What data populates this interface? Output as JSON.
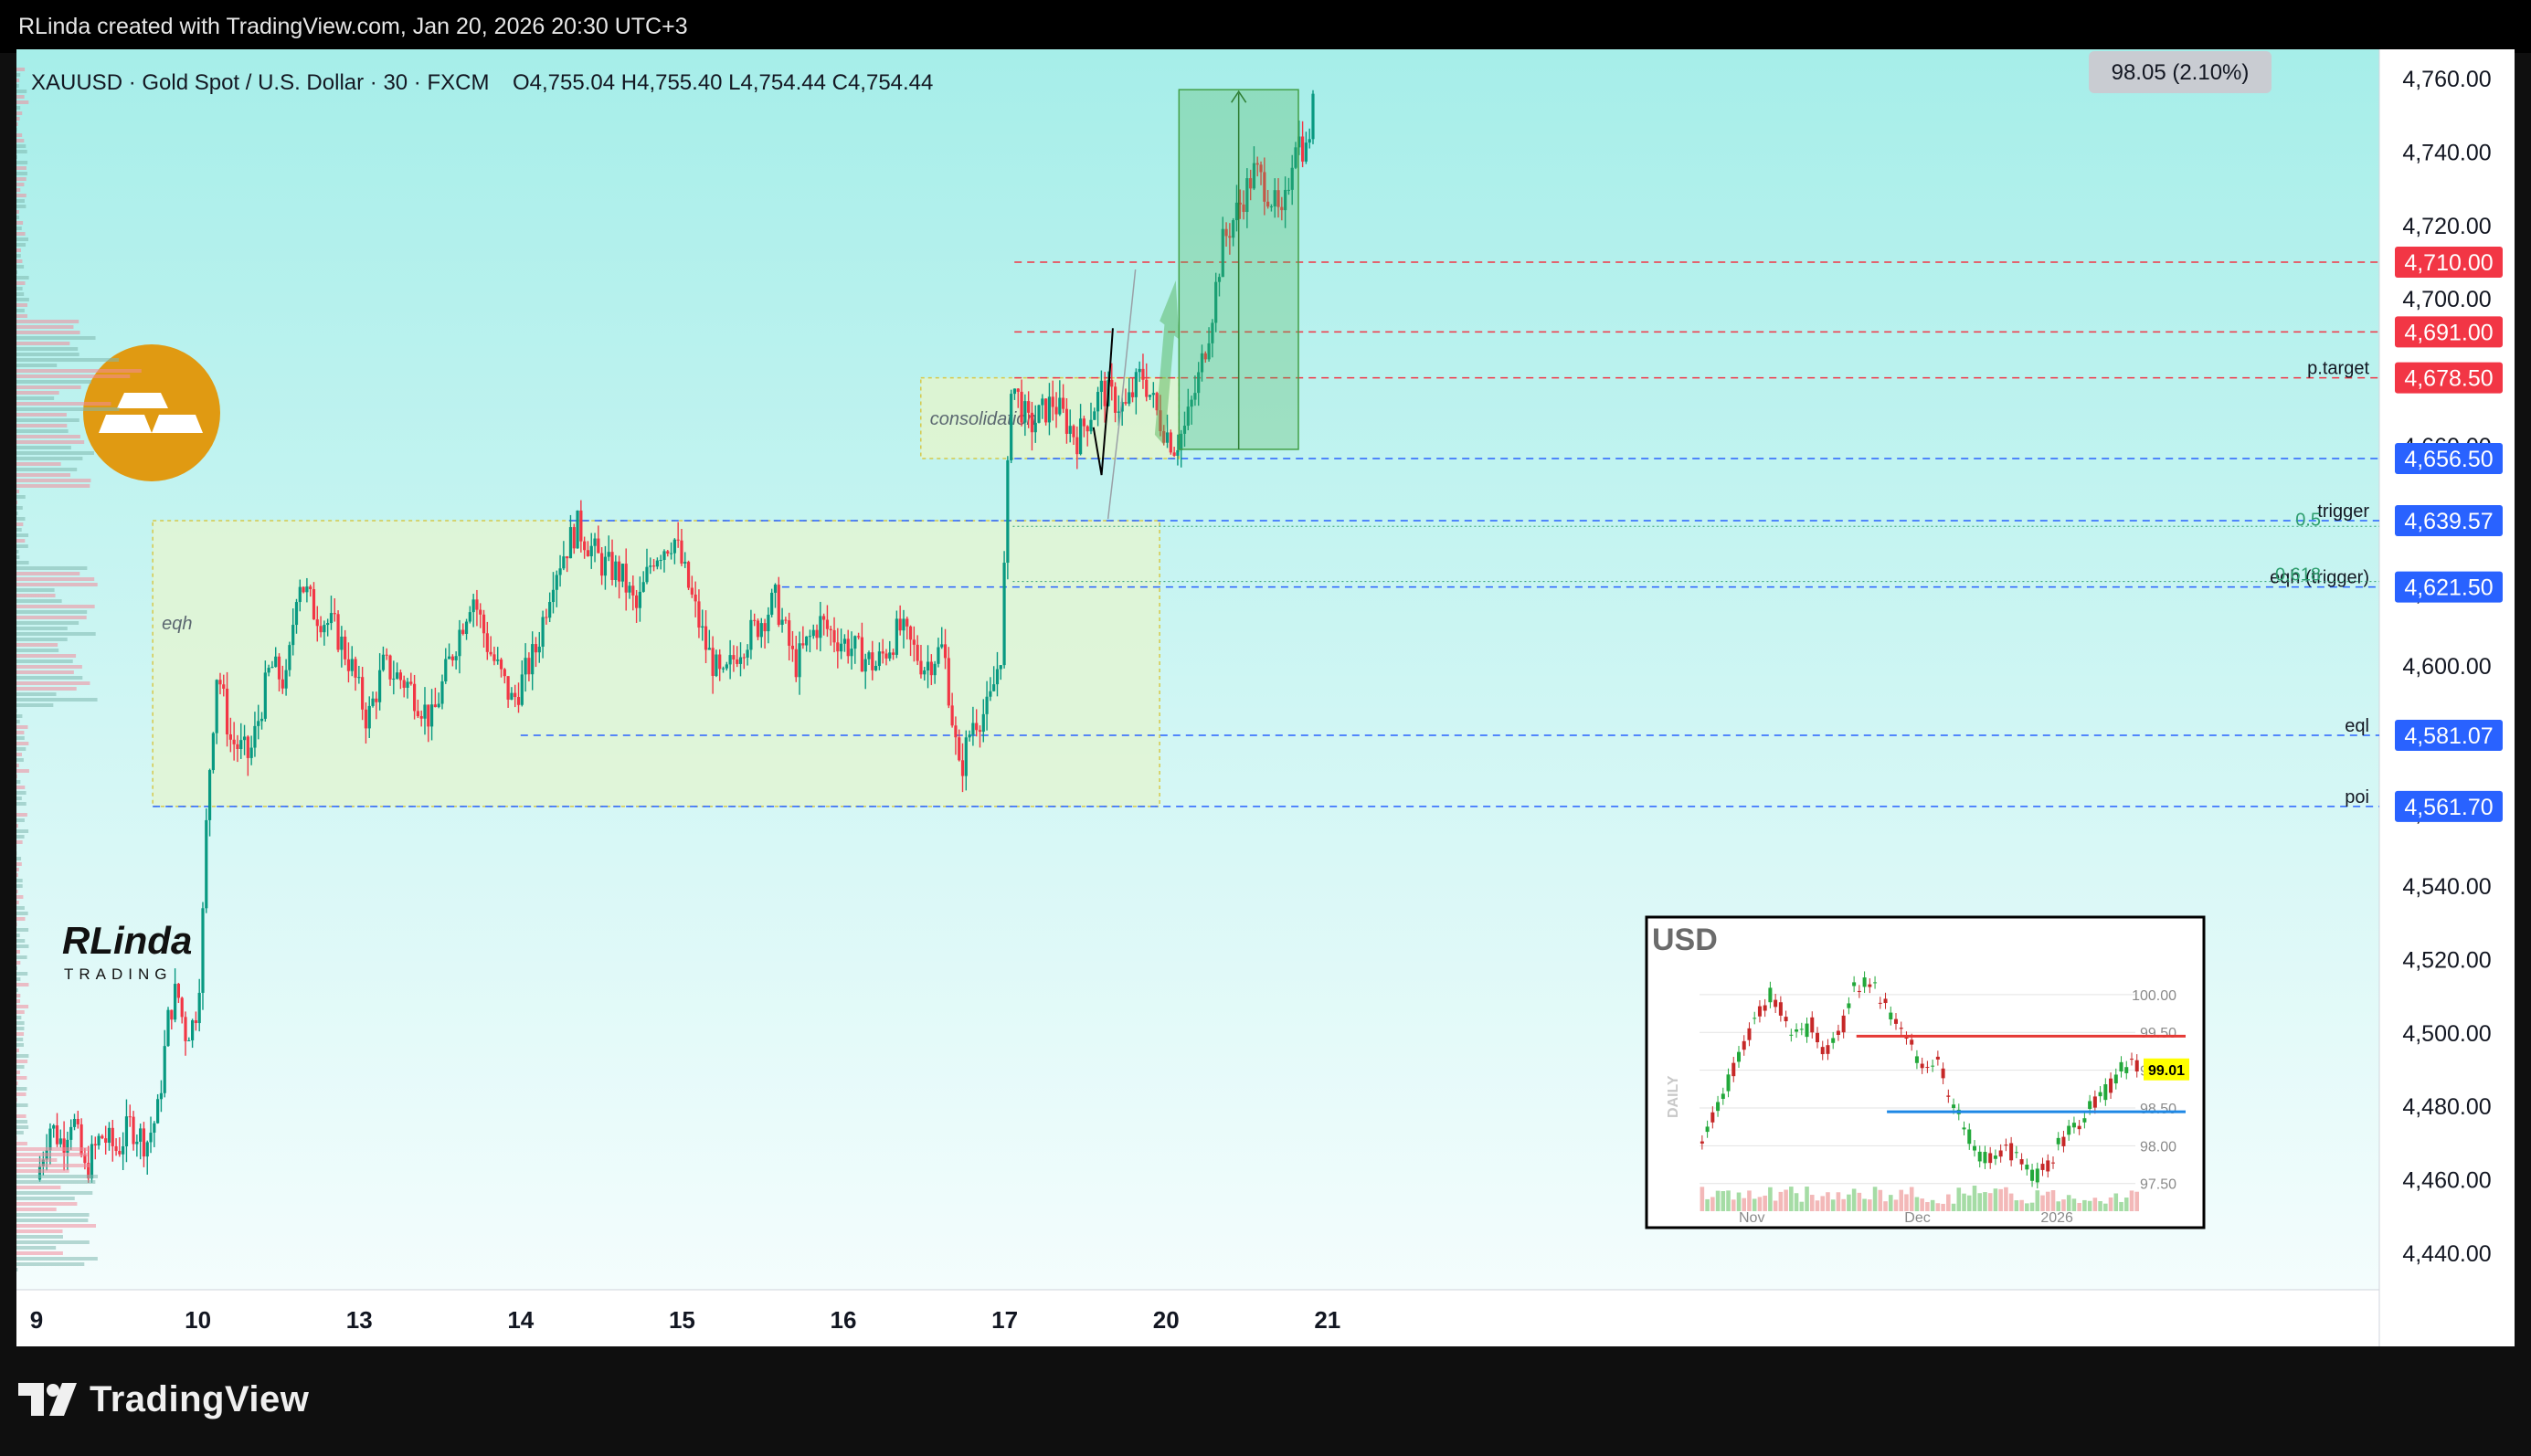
{
  "top_bar": {
    "credit": "RLinda created with TradingView.com, Jan 20, 2026 20:30 UTC+3"
  },
  "header": {
    "symbol": "XAUUSD · Gold Spot / U.S. Dollar · 30 · FXCM",
    "ohlc": "O4,755.04  H4,755.40  L4,754.44  C4,754.44"
  },
  "measure_label": "98.05 (2.10%)",
  "watermark": {
    "brand_line1": "RLinda",
    "brand_line2": "TRADING"
  },
  "footer": {
    "brand": "TradingView"
  },
  "colors": {
    "up": "#089981",
    "down": "#f23645",
    "bg_top": "#a6eee9",
    "bg_bottom": "#f4fdfd",
    "zone": "#e2f4d4",
    "level_red": "#f23645",
    "level_blue": "#2962ff",
    "logo_gold": "#e09a12"
  },
  "chart_data": {
    "type": "candlestick",
    "y_axis": {
      "min": 4430,
      "max": 4768,
      "ticks": [
        4440,
        4460,
        4480,
        4500,
        4520,
        4540,
        4560,
        4580,
        4600,
        4620,
        4640,
        4660,
        4680,
        4700,
        4720,
        4740,
        4760
      ],
      "tick_labels": [
        "4,440.00",
        "4,460.00",
        "4,480.00",
        "4,500.00",
        "4,520.00",
        "4,540.00",
        "4,560.00",
        "4,580.00",
        "4,600.00",
        "4,620.00",
        "4,640.00",
        "4,660.00",
        "4,680.00",
        "4,700.00",
        "4,720.00",
        "4,740.00",
        "4,760.00"
      ]
    },
    "x_axis": {
      "labels": [
        "9",
        "10",
        "13",
        "14",
        "15",
        "16",
        "17",
        "20",
        "21"
      ],
      "positions": [
        0.0,
        1.0,
        2.0,
        3.0,
        4.0,
        5.0,
        6.0,
        7.0,
        8.0
      ]
    },
    "price_path": [
      [
        0.0,
        4460
      ],
      [
        0.08,
        4475
      ],
      [
        0.16,
        4470
      ],
      [
        0.22,
        4478
      ],
      [
        0.3,
        4462
      ],
      [
        0.4,
        4472
      ],
      [
        0.5,
        4468
      ],
      [
        0.58,
        4475
      ],
      [
        0.68,
        4470
      ],
      [
        0.75,
        4478
      ],
      [
        0.82,
        4505
      ],
      [
        0.87,
        4512
      ],
      [
        0.92,
        4500
      ],
      [
        0.98,
        4503
      ],
      [
        1.02,
        4520
      ],
      [
        1.06,
        4565
      ],
      [
        1.12,
        4600
      ],
      [
        1.2,
        4580
      ],
      [
        1.32,
        4575
      ],
      [
        1.45,
        4600
      ],
      [
        1.55,
        4595
      ],
      [
        1.62,
        4625
      ],
      [
        1.72,
        4615
      ],
      [
        1.85,
        4610
      ],
      [
        1.95,
        4600
      ],
      [
        2.05,
        4585
      ],
      [
        2.15,
        4600
      ],
      [
        2.3,
        4595
      ],
      [
        2.45,
        4585
      ],
      [
        2.55,
        4600
      ],
      [
        2.7,
        4620
      ],
      [
        2.8,
        4605
      ],
      [
        2.95,
        4590
      ],
      [
        3.1,
        4605
      ],
      [
        3.2,
        4625
      ],
      [
        3.35,
        4638
      ],
      [
        3.5,
        4628
      ],
      [
        3.62,
        4625
      ],
      [
        3.72,
        4615
      ],
      [
        3.82,
        4630
      ],
      [
        3.95,
        4635
      ],
      [
        4.05,
        4620
      ],
      [
        4.15,
        4605
      ],
      [
        4.25,
        4595
      ],
      [
        4.35,
        4605
      ],
      [
        4.45,
        4610
      ],
      [
        4.58,
        4618
      ],
      [
        4.7,
        4600
      ],
      [
        4.85,
        4612
      ],
      [
        4.95,
        4608
      ],
      [
        5.05,
        4605
      ],
      [
        5.2,
        4600
      ],
      [
        5.35,
        4610
      ],
      [
        5.5,
        4600
      ],
      [
        5.62,
        4605
      ],
      [
        5.72,
        4570
      ],
      [
        5.8,
        4585
      ],
      [
        5.9,
        4588
      ],
      [
        5.98,
        4605
      ],
      [
        6.04,
        4678
      ],
      [
        6.15,
        4665
      ],
      [
        6.3,
        4672
      ],
      [
        6.45,
        4662
      ],
      [
        6.6,
        4675
      ],
      [
        6.75,
        4670
      ],
      [
        6.85,
        4680
      ],
      [
        6.95,
        4668
      ],
      [
        7.05,
        4660
      ],
      [
        7.12,
        4665
      ],
      [
        7.2,
        4678
      ],
      [
        7.28,
        4695
      ],
      [
        7.35,
        4715
      ],
      [
        7.45,
        4725
      ],
      [
        7.55,
        4735
      ],
      [
        7.65,
        4728
      ],
      [
        7.72,
        4720
      ],
      [
        7.8,
        4745
      ],
      [
        7.87,
        4740
      ],
      [
        7.92,
        4755
      ]
    ],
    "levels": [
      {
        "label": "4,710.00",
        "value": 4710.0,
        "color": "#f23645",
        "name": ""
      },
      {
        "label": "4,691.00",
        "value": 4691.0,
        "color": "#f23645",
        "name": ""
      },
      {
        "label": "4,678.50",
        "value": 4678.5,
        "color": "#f23645",
        "name": "p.target"
      },
      {
        "label": "4,656.50",
        "value": 4656.5,
        "color": "#2962ff",
        "name": ""
      },
      {
        "label": "4,639.57",
        "value": 4639.57,
        "color": "#2962ff",
        "name": "trigger"
      },
      {
        "label": "4,621.50",
        "value": 4621.5,
        "color": "#2962ff",
        "name": "eqh (trigger)"
      },
      {
        "label": "4,581.07",
        "value": 4581.07,
        "color": "#2962ff",
        "name": "eql"
      },
      {
        "label": "4,561.70",
        "value": 4561.7,
        "color": "#2962ff",
        "name": "poi"
      }
    ],
    "zones": [
      {
        "label": "eqh",
        "x_from": 0.72,
        "x_to": 6.96,
        "y_from": 4561.7,
        "y_to": 4639.57
      },
      {
        "label": "consolidation",
        "x_from": 5.48,
        "x_to": 7.08,
        "y_from": 4656.5,
        "y_to": 4678.5
      }
    ],
    "fib_levels": [
      {
        "label": "0.5",
        "value": 4638
      },
      {
        "label": "0.618",
        "value": 4623
      }
    ],
    "measure": {
      "x_from": 7.08,
      "x_to": 7.82,
      "y_from": 4659,
      "y_to": 4757,
      "label": "98.05 (2.10%)"
    },
    "inset": {
      "title": "USD",
      "side_label": "DAILY",
      "y_ticks": [
        "100.00",
        "99.50",
        "99.00",
        "98.50",
        "98.00",
        "97.50"
      ],
      "x_ticks": [
        "Nov",
        "Dec",
        "2026"
      ],
      "last_price": "99.01",
      "path": [
        98.1,
        98.4,
        98.9,
        99.3,
        99.8,
        100.0,
        99.7,
        99.4,
        99.6,
        99.2,
        99.5,
        100.1,
        100.2,
        99.9,
        99.6,
        99.3,
        99.1,
        99.2,
        98.6,
        98.2,
        97.9,
        97.8,
        98.0,
        97.7,
        97.6,
        97.8,
        98.1,
        98.3,
        98.5,
        98.7,
        99.0,
        99.1
      ]
    }
  }
}
